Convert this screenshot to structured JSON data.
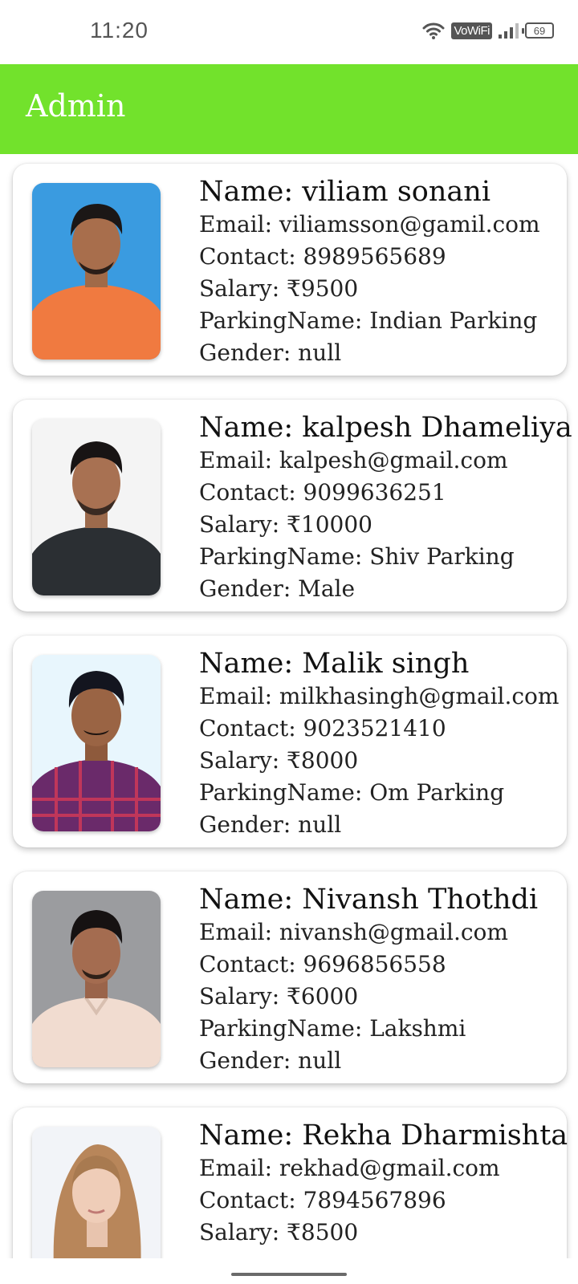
{
  "status_bar": {
    "time": "11:20",
    "network_badge": "VoWiFi",
    "battery_level": "69",
    "icons": [
      "wifi-icon",
      "signal-icon",
      "battery-icon"
    ]
  },
  "app_bar": {
    "title": "Admin",
    "color": "#72e22c"
  },
  "employees": [
    {
      "name": "Name: viliam sonani",
      "email": "Email: viliamsson@gamil.com",
      "contact": "Contact: 8989565689",
      "salary": "Salary: ₹9500",
      "parking": "ParkingName: Indian Parking",
      "gender": "Gender: null",
      "photo_bg": "#3a9be0",
      "shirt": "#f07a40"
    },
    {
      "name": "Name: kalpesh Dhameliya",
      "email": "Email: kalpesh@gmail.com",
      "contact": "Contact: 9099636251",
      "salary": "Salary: ₹10000",
      "parking": "ParkingName: Shiv Parking",
      "gender": "Gender: Male",
      "photo_bg": "#f4f4f4",
      "shirt": "#2b2f33"
    },
    {
      "name": "Name: Malik singh",
      "email": "Email: milkhasingh@gmail.com",
      "contact": "Contact: 9023521410",
      "salary": "Salary: ₹8000",
      "parking": "ParkingName: Om Parking",
      "gender": "Gender: null",
      "photo_bg": "#e8f6fd",
      "shirt": "#6a2a6a"
    },
    {
      "name": "Name: Nivansh Thothdi",
      "email": "Email: nivansh@gmail.com",
      "contact": "Contact: 9696856558",
      "salary": "Salary: ₹6000",
      "parking": "ParkingName: Lakshmi",
      "gender": "Gender: null",
      "photo_bg": "#9b9c9f",
      "shirt": "#f1dcd0"
    },
    {
      "name": "Name: Rekha Dharmishta",
      "email": "Email: rekhad@gmail.com",
      "contact": "Contact: 7894567896",
      "salary": "Salary: ₹8500",
      "parking": "",
      "gender": "",
      "photo_bg": "#f2f4f8",
      "shirt": "#b8865a"
    }
  ]
}
